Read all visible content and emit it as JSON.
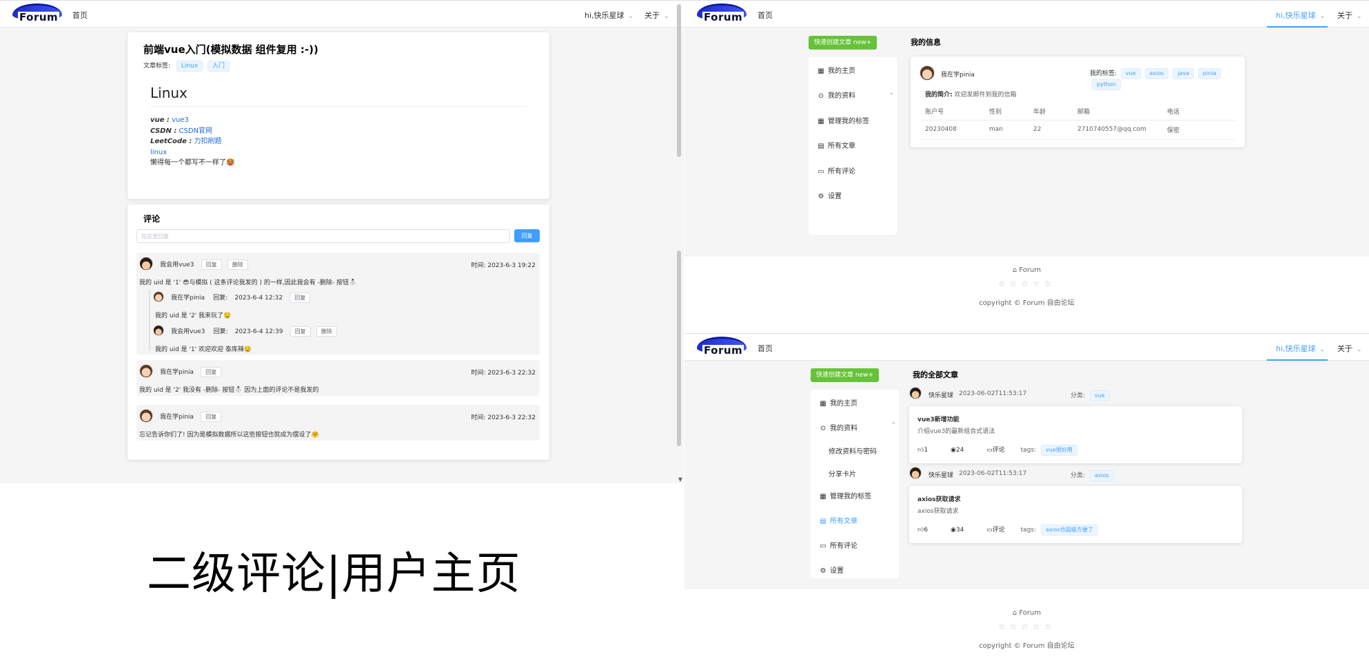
{
  "logo_text": "Forum",
  "left_panel": {
    "nav": {
      "home": "首页",
      "user": "hi,快乐星球",
      "about": "关于"
    },
    "article": {
      "title": "前端vue入门(模拟数据 组件复用 :-))",
      "tags_label": "文章标签:",
      "tags": [
        "Linux",
        "入门"
      ],
      "heading": "Linux",
      "links": [
        {
          "label": "vue :",
          "value": "vue3"
        },
        {
          "label": "CSDN :",
          "value": "CSDN官网"
        },
        {
          "label": "LeetCode :",
          "value": "力扣刷题"
        }
      ],
      "plain_link": "linux",
      "body_text": "懒得每一个都写不一样了🥵"
    },
    "comments": {
      "title": "评论",
      "input_placeholder": "在这里回复",
      "reply_button": "回复",
      "reply": "回复",
      "delete": "删除",
      "replied": "回复:",
      "time_prefix": "时间:",
      "c1": {
        "user": "我会用vue3",
        "time": "2023-6-3 19:22",
        "text": "我的 uid 是 '1' 😎与模拟 ( 这条评论我发的 ) 的一样,因此我会有 -删除- 按钮⛄",
        "r1": {
          "user": "我在学pinia",
          "time": "2023-6-4 12:32",
          "text": "我的 uid 是 '2' 我来玩了🤤"
        },
        "r2": {
          "user": "我会用vue3",
          "time": "2023-6-4 12:39",
          "text": "我的 uid 是 '1' 欢迎欢迎 泰库辣🤤"
        }
      },
      "c2": {
        "user": "我在学pinia",
        "time": "2023-6-3 22:32",
        "text": "我的 uid 是 '2' 我没有 -删除- 按钮⛄ 因为上面的评论不是我发的"
      },
      "c3": {
        "user": "我在学pinia",
        "time": "2023-6-3 22:32",
        "text": "忘记告诉你们了! 因为是模拟数据所以这些按钮也就成为摆设了🤗"
      }
    }
  },
  "caption": "二级评论|用户主页",
  "right_top": {
    "nav": {
      "home": "首页",
      "user": "hi,快乐星球",
      "about": "关于"
    },
    "quick_button": "快速创建文章 new+",
    "menu": [
      "我的主页",
      "我的资料",
      "管理我的标签",
      "所有文章",
      "所有评论",
      "设置"
    ],
    "section_title": "我的信息",
    "username": "我在学pinia",
    "my_tags_label": "我的标签:",
    "my_tags": [
      "vue",
      "axios",
      "java",
      "pinia",
      "python"
    ],
    "intro_label": "我的简介:",
    "intro": "欢迎发邮件到我的信箱",
    "table_headers": [
      "账户号",
      "性别",
      "年龄",
      "邮箱",
      "电话"
    ],
    "table_row": [
      "20230408",
      "man",
      "22",
      "2710740557@qq.com",
      "保密"
    ],
    "footer_brand": "Forum",
    "copyright": "copyright © Forum 自由论坛"
  },
  "right_bottom": {
    "nav": {
      "home": "首页",
      "user": "hi,快乐星球",
      "about": "关于"
    },
    "quick_button": "快速创建文章 new+",
    "menu": [
      "我的主页",
      "我的资料",
      "修改资料与密码",
      "分享卡片",
      "管理我的标签",
      "所有文章",
      "所有评论",
      "设置"
    ],
    "section_title": "我的全部文章",
    "category_label": "分类:",
    "comment_label": "评论",
    "tags_label": "tags:",
    "posts": [
      {
        "author": "快乐星球",
        "time": "2023-06-02T11:53:17",
        "category": "vue",
        "title": "vue3新增功能",
        "desc": "介绍vue3的最新组合式语法",
        "likes": "1",
        "views": "24",
        "tag": "vue很好用"
      },
      {
        "author": "快乐星球",
        "time": "2023-06-02T11:53:17",
        "category": "axios",
        "title": "axios获取请求",
        "desc": "axios获取请求",
        "likes": "6",
        "views": "34",
        "tag": "axios也超级方便了"
      }
    ],
    "footer_brand": "Forum",
    "copyright": "copyright © Forum 自由论坛"
  }
}
